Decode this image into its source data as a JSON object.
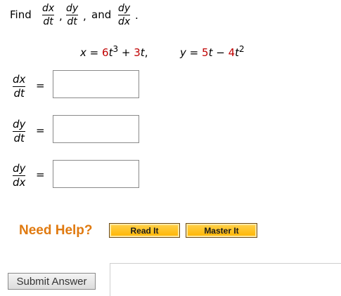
{
  "prompt": {
    "find": "Find",
    "f1": {
      "num": "dx",
      "den": "dt"
    },
    "comma1": ",",
    "f2": {
      "num": "dy",
      "den": "dt"
    },
    "comma2": ",",
    "and": "and",
    "f3": {
      "num": "dy",
      "den": "dx"
    },
    "period": "."
  },
  "equations": {
    "x": {
      "lhs": "x",
      "eq": "=",
      "c1": "6",
      "var1": "t",
      "exp1": "3",
      "plus": "+",
      "c2": "3",
      "var2": "t",
      "comma": ","
    },
    "y": {
      "lhs": "y",
      "eq": "=",
      "c1": "5",
      "var1": "t",
      "minus": "−",
      "c2": "4",
      "var2": "t",
      "exp2": "2"
    }
  },
  "answers": [
    {
      "num": "dx",
      "den": "dt",
      "eq": "=",
      "value": ""
    },
    {
      "num": "dy",
      "den": "dt",
      "eq": "=",
      "value": ""
    },
    {
      "num": "dy",
      "den": "dx",
      "eq": "=",
      "value": ""
    }
  ],
  "help": {
    "title": "Need Help?",
    "read_it": "Read It",
    "master_it": "Master It"
  },
  "submit_label": "Submit Answer",
  "colors": {
    "accent_orange": "#e07a10",
    "coefficient_red": "#c00000",
    "button_gold": "#ffc21a"
  }
}
